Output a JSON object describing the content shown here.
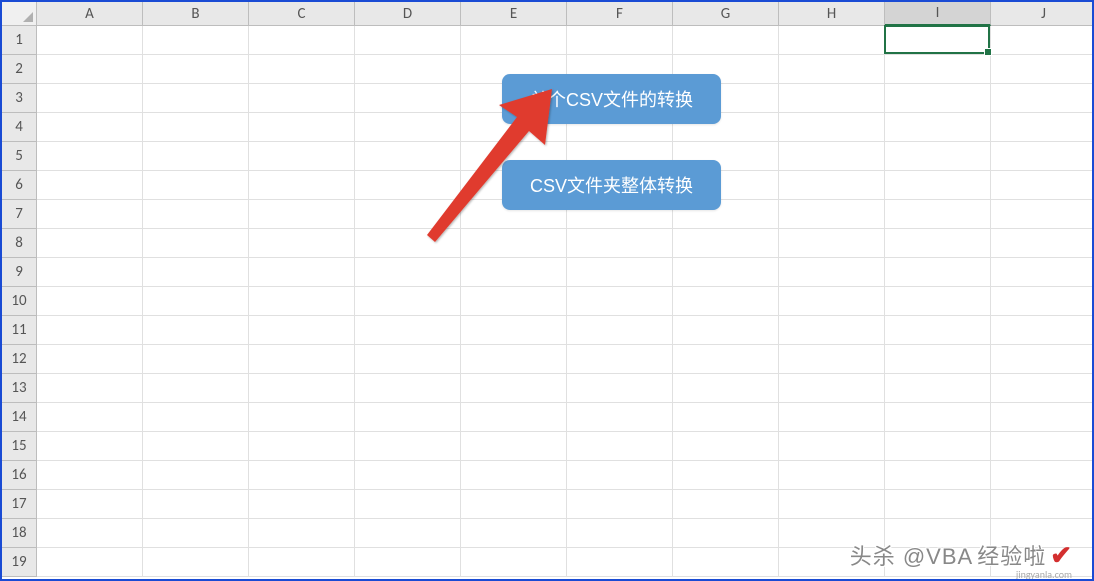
{
  "columns": [
    "A",
    "B",
    "C",
    "D",
    "E",
    "F",
    "G",
    "H",
    "I",
    "J"
  ],
  "rows": [
    "1",
    "2",
    "3",
    "4",
    "5",
    "6",
    "7",
    "8",
    "9",
    "10",
    "11",
    "12",
    "13",
    "14",
    "15",
    "16",
    "17",
    "18",
    "19"
  ],
  "active_column_index": 8,
  "active_row_index": 0,
  "buttons": {
    "single_csv_convert": "单个CSV文件的转换",
    "folder_csv_convert": "CSV文件夹整体转换"
  },
  "watermark": {
    "prefix": "头杀 @VBA",
    "suffix": "经验啦",
    "domain": "jingyanla.com"
  },
  "colors": {
    "button_bg": "#5b9bd5",
    "button_text": "#ffffff",
    "arrow": "#e03b2f",
    "active_border": "#217346",
    "grid_line": "#e0e0e0",
    "header_bg": "#e8e8e8",
    "frame_border": "#1a4bd4"
  }
}
